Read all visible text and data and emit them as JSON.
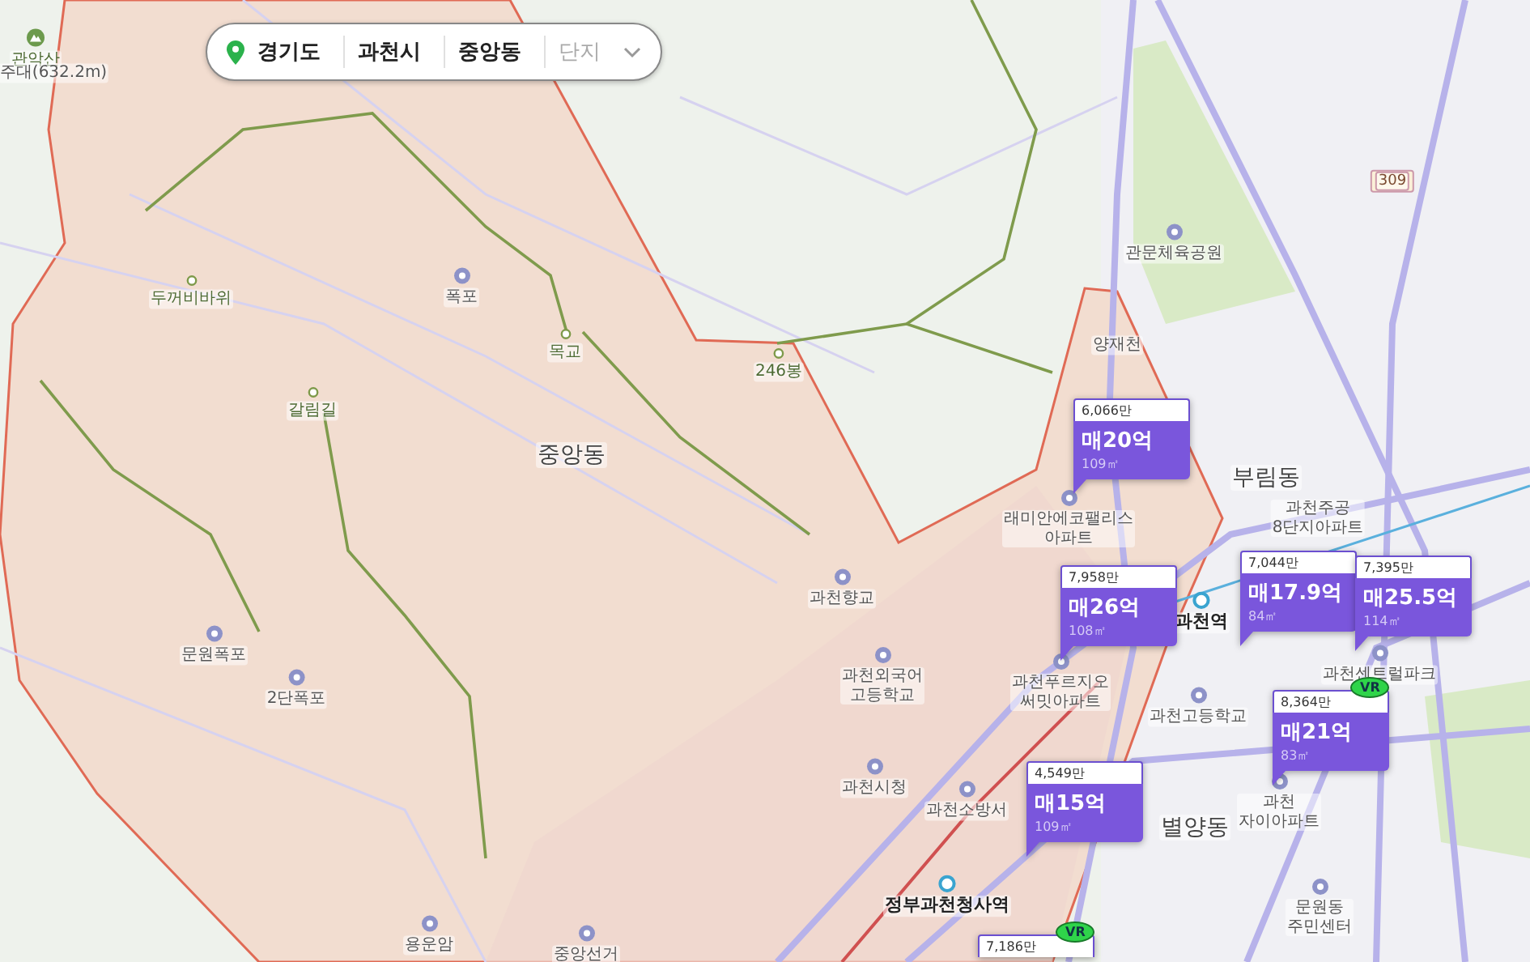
{
  "breadcrumb": [
    {
      "label": "경기도",
      "muted": false
    },
    {
      "label": "과천시",
      "muted": false
    },
    {
      "label": "중앙동",
      "muted": false
    },
    {
      "label": "단지",
      "muted": true
    }
  ],
  "labels": [
    {
      "text": "관악산",
      "kind": "peak"
    },
    {
      "text": "주대(632.2m)",
      "kind": "place"
    },
    {
      "text": "두꺼비바위",
      "kind": "trail"
    },
    {
      "text": "폭포",
      "kind": "poi"
    },
    {
      "text": "목교",
      "kind": "trail"
    },
    {
      "text": "246봉",
      "kind": "trail"
    },
    {
      "text": "갈림길",
      "kind": "trail"
    },
    {
      "text": "중앙동",
      "kind": "district"
    },
    {
      "text": "과천향교",
      "kind": "poi"
    },
    {
      "text": "문원폭포",
      "kind": "poi"
    },
    {
      "text": "2단폭포",
      "kind": "poi"
    },
    {
      "text": "용운암",
      "kind": "poi"
    },
    {
      "text": "중앙선거",
      "kind": "poi"
    },
    {
      "text": "관문체육공원",
      "kind": "poi"
    },
    {
      "text": "양재천",
      "kind": "place"
    },
    {
      "text": "래미안에코팰리스\n아파트",
      "kind": "poi"
    },
    {
      "text": "부림동",
      "kind": "district"
    },
    {
      "text": "과천주공\n8단지아파트",
      "kind": "place"
    },
    {
      "text": "과천역",
      "kind": "station"
    },
    {
      "text": "과천외국어\n고등학교",
      "kind": "poi"
    },
    {
      "text": "과천푸르지오\n써밋아파트",
      "kind": "poi"
    },
    {
      "text": "과천센트럴파크",
      "kind": "poi"
    },
    {
      "text": "과천고등학교",
      "kind": "poi"
    },
    {
      "text": "과천시청",
      "kind": "poi"
    },
    {
      "text": "과천소방서",
      "kind": "poi"
    },
    {
      "text": "별양동",
      "kind": "district"
    },
    {
      "text": "과천\n자이아파트",
      "kind": "poi"
    },
    {
      "text": "정부과천청사역",
      "kind": "station"
    },
    {
      "text": "문원동\n주민센터",
      "kind": "poi"
    },
    {
      "text": "309",
      "kind": "route"
    }
  ],
  "listings": [
    {
      "per_area": "6,066만",
      "price": "매20억",
      "area": "109㎡"
    },
    {
      "per_area": "7,958만",
      "price": "매26억",
      "area": "108㎡"
    },
    {
      "per_area": "7,044만",
      "price": "매17.9억",
      "area": "84㎡"
    },
    {
      "per_area": "7,395만",
      "price": "매25.5억",
      "area": "114㎡"
    },
    {
      "per_area": "8,364만",
      "price": "매21억",
      "area": "83㎡",
      "badge": "VR"
    },
    {
      "per_area": "4,549만",
      "price": "매15억",
      "area": "109㎡"
    },
    {
      "per_area": "7,186만",
      "badge": "VR"
    }
  ]
}
